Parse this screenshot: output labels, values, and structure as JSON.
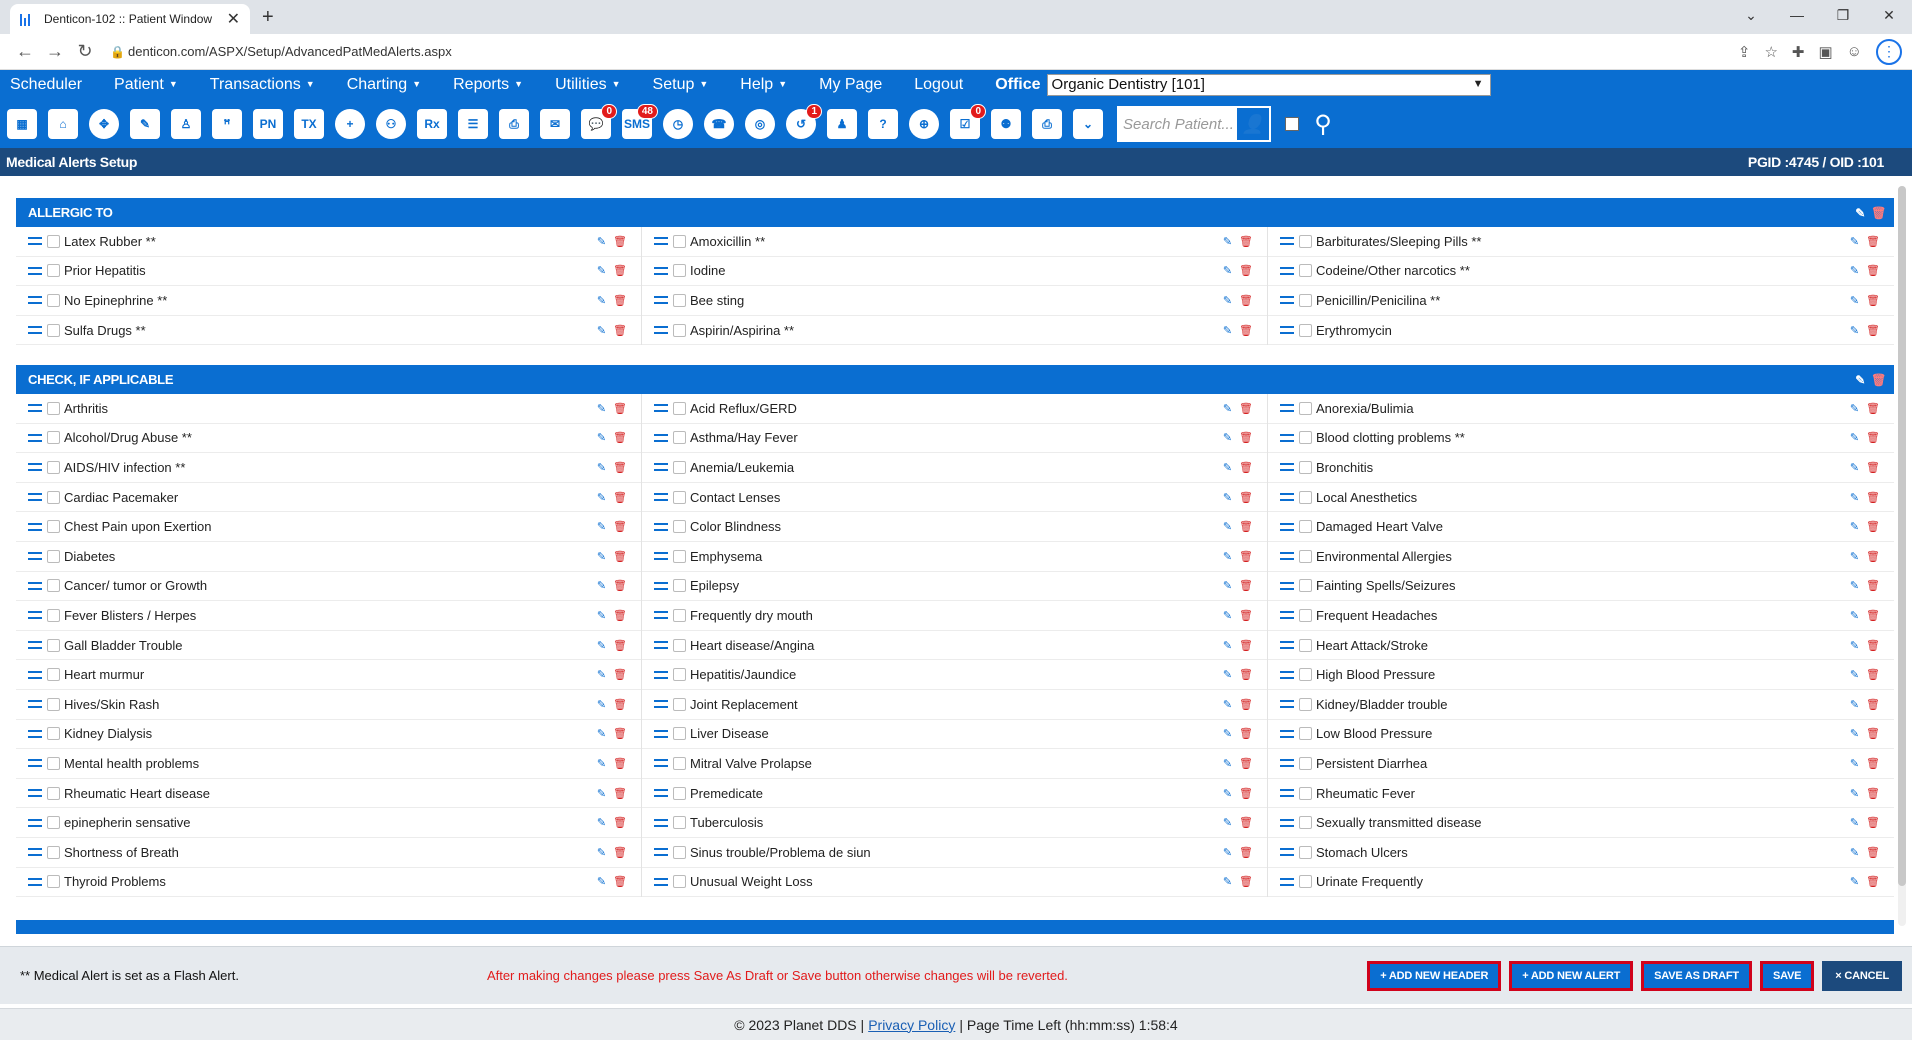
{
  "browser": {
    "tab_title": "Denticon-102 :: Patient Window",
    "url": "denticon.com/ASPX/Setup/AdvancedPatMedAlerts.aspx"
  },
  "menu": {
    "items": [
      "Scheduler",
      "Patient",
      "Transactions",
      "Charting",
      "Reports",
      "Utilities",
      "Setup",
      "Help",
      "My Page",
      "Logout"
    ],
    "office_label": "Office",
    "office_value": "Organic Dentistry [101]"
  },
  "toolbar": {
    "badges": {
      "messages": "0",
      "sms": "48",
      "recall": "1",
      "alerts": "0"
    },
    "search_placeholder": "Search Patient..."
  },
  "page": {
    "title": "Medical Alerts Setup",
    "ids": "PGID :4745  /  OID :101"
  },
  "sections": [
    {
      "header": "ALLERGIC TO",
      "columns": [
        [
          "Latex Rubber **",
          "Prior Hepatitis",
          "No Epinephrine **",
          "Sulfa Drugs **"
        ],
        [
          "Amoxicillin **",
          "Iodine",
          "Bee sting",
          "Aspirin/Aspirina **"
        ],
        [
          "Barbiturates/Sleeping Pills **",
          "Codeine/Other narcotics **",
          "Penicillin/Penicilina **",
          "Erythromycin"
        ]
      ]
    },
    {
      "header": "CHECK, IF APPLICABLE",
      "columns": [
        [
          "Arthritis",
          "Alcohol/Drug Abuse **",
          "AIDS/HIV infection **",
          "Cardiac Pacemaker",
          "Chest Pain upon Exertion",
          "Diabetes",
          "Cancer/ tumor or Growth",
          "Fever Blisters / Herpes",
          "Gall Bladder Trouble",
          "Heart murmur",
          "Hives/Skin Rash",
          "Kidney Dialysis",
          "Mental health problems",
          "Rheumatic Heart disease",
          "epinepherin sensative",
          "Shortness of Breath",
          "Thyroid Problems"
        ],
        [
          "Acid Reflux/GERD",
          "Asthma/Hay Fever",
          "Anemia/Leukemia",
          "Contact Lenses",
          "Color Blindness",
          "Emphysema",
          "Epilepsy",
          "Frequently dry mouth",
          "Heart disease/Angina",
          "Hepatitis/Jaundice",
          "Joint Replacement",
          "Liver Disease",
          "Mitral Valve Prolapse",
          "Premedicate",
          "Tuberculosis",
          "Sinus trouble/Problema de siun",
          "Unusual Weight Loss"
        ],
        [
          "Anorexia/Bulimia",
          "Blood clotting problems **",
          "Bronchitis",
          "Local Anesthetics",
          "Damaged Heart Valve",
          "Environmental Allergies",
          "Fainting Spells/Seizures",
          "Frequent Headaches",
          "Heart Attack/Stroke",
          "High Blood Pressure",
          "Kidney/Bladder trouble",
          "Low Blood Pressure",
          "Persistent Diarrhea",
          "Rheumatic Fever",
          "Sexually transmitted disease",
          "Stomach Ulcers",
          "Urinate Frequently"
        ]
      ]
    }
  ],
  "footer": {
    "note": "** Medical Alert is set as a Flash Alert.",
    "warning": "After making changes please press Save As Draft or Save button otherwise changes will be reverted.",
    "buttons": {
      "add_header": "+ ADD NEW HEADER",
      "add_alert": "+ ADD NEW ALERT",
      "save_draft": "SAVE AS DRAFT",
      "save": "SAVE",
      "cancel": "× CANCEL"
    }
  },
  "copyright": {
    "text": "© 2023 Planet DDS |",
    "privacy": "Privacy Policy",
    "time_left": "|  Page Time Left (hh:mm:ss) 1:58:4"
  }
}
